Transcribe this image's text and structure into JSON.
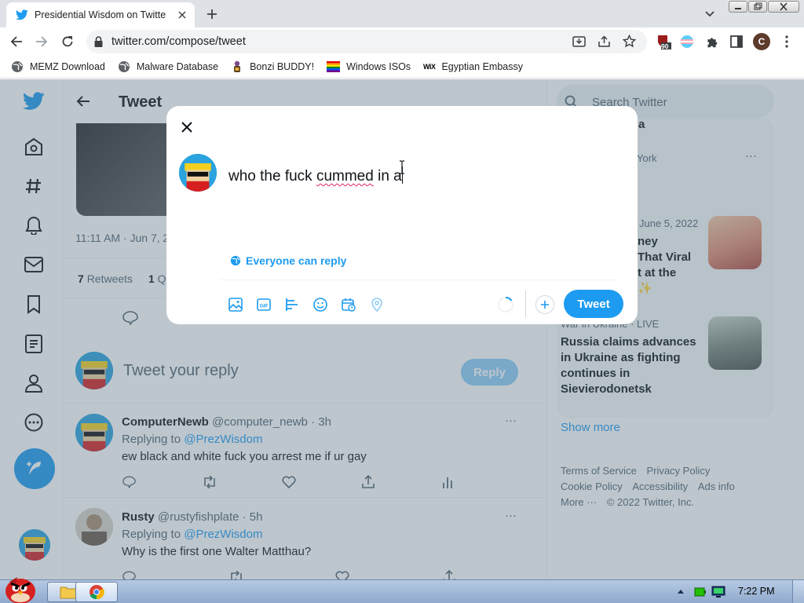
{
  "browser": {
    "tab_title": "Presidential Wisdom on Twitte",
    "url": "twitter.com/compose/tweet",
    "ext_badge": "90",
    "profile_initial": "C",
    "bookmarks": [
      {
        "label": "MEMZ Download",
        "icon": "globe-icon"
      },
      {
        "label": "Malware Database",
        "icon": "globe-icon"
      },
      {
        "label": "Bonzi BUDDY!",
        "icon": "bonzi-icon"
      },
      {
        "label": "Windows ISOs",
        "icon": "rainbow-flag-icon"
      },
      {
        "label": "Egyptian Embassy",
        "icon": "wix-icon"
      }
    ]
  },
  "twitter": {
    "header_title": "Tweet",
    "tweet_time": "11:11 AM · Jun 7, 2",
    "retweets_count": "7",
    "retweets_label": "Retweets",
    "quotes_count": "1",
    "quotes_label": "Qu",
    "reply_placeholder": "Tweet your reply",
    "reply_button": "Reply",
    "replies": [
      {
        "name": "ComputerNewb",
        "handle": "@computer_newb · 3h",
        "replying_label": "Replying to",
        "replying_to": "@PrezWisdom",
        "text": "ew black and white fuck you arrest me if ur gay",
        "more": "···"
      },
      {
        "name": "Rusty",
        "handle": "@rustyfishplate · 5h",
        "replying_label": "Replying to",
        "replying_to": "@PrezWisdom",
        "text": "Why is the first one Walter Matthau?",
        "more": "···"
      }
    ],
    "search_placeholder": "Search Twitter",
    "sidebar": {
      "partial_top": "a",
      "partial_ny": "York",
      "trend1_meta": "June 5, 2022",
      "trend1_lines": [
        "ney",
        "That Viral",
        "t at the",
        "✨"
      ],
      "trend2_meta": "War in Ukraine · LIVE",
      "trend2_title": "Russia claims advances in Ukraine as fighting continues in Sievierodonetsk",
      "show_more": "Show more",
      "footer": {
        "terms": "Terms of Service",
        "privacy": "Privacy Policy",
        "cookie": "Cookie Policy",
        "accessibility": "Accessibility",
        "ads": "Ads info",
        "more": "More ···",
        "copyright": "© 2022 Twitter, Inc."
      }
    },
    "compose": {
      "text_before": "who the fuck ",
      "text_misspelled": "cummed",
      "text_after": " in a",
      "everyone_can_reply": "Everyone can reply",
      "tweet_button": "Tweet"
    }
  },
  "taskbar": {
    "clock": "7:22 PM"
  }
}
